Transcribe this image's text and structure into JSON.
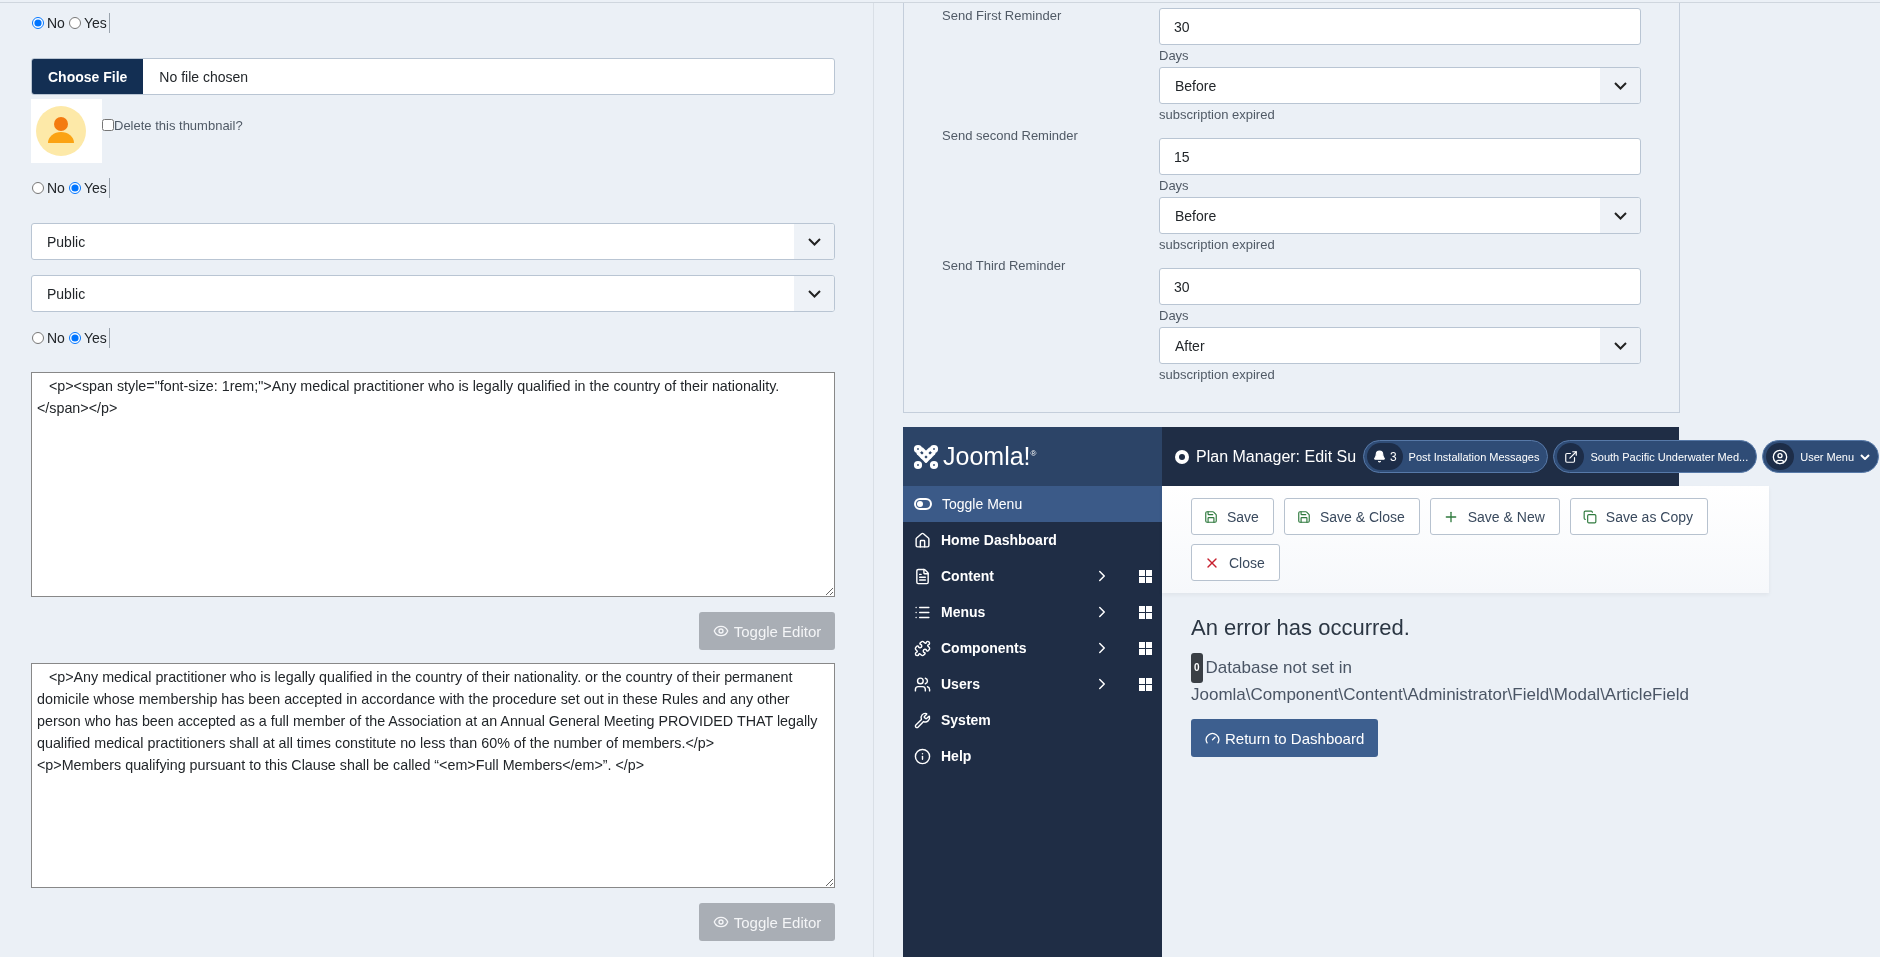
{
  "left_form": {
    "items": [
      {
        "kind": "radio",
        "options": [
          {
            "label": "No",
            "selected": true
          },
          {
            "label": "Yes",
            "selected": false
          }
        ]
      },
      {
        "kind": "file",
        "button": "Choose File",
        "status": "No file chosen"
      },
      {
        "kind": "thumbnail",
        "checkbox_label": "Delete this thumbnail?",
        "checked": false
      },
      {
        "kind": "radio",
        "options": [
          {
            "label": "No",
            "selected": false
          },
          {
            "label": "Yes",
            "selected": true
          }
        ]
      },
      {
        "kind": "select",
        "value": "Public"
      },
      {
        "kind": "select",
        "value": "Public"
      },
      {
        "kind": "radio",
        "options": [
          {
            "label": "No",
            "selected": false
          },
          {
            "label": "Yes",
            "selected": true
          }
        ]
      },
      {
        "kind": "editor",
        "value": "   <p><span style=\"font-size: 1rem;\">Any medical practitioner who is legally qualified in the country of their nationality.\n</span></p>",
        "toggle": {
          "label": "Toggle Editor",
          "disabled": true
        }
      },
      {
        "kind": "editor",
        "value": "   <p>Any medical practitioner who is legally qualified in the country of their nationality. or the country of their permanent domicile whose membership has been accepted in accordance with the procedure set out in these Rules and any other person who has been accepted as a full member of the Association at an Annual General Meeting PROVIDED THAT legally qualified medical practitioners shall at all times constitute no less than 60% of the number of members.</p>\n<p>Members qualifying pursuant to this Clause shall be called “<em>Full Members</em>”. </p>",
        "toggle": {
          "label": "Toggle Editor",
          "disabled": true
        }
      }
    ]
  },
  "reminders": [
    {
      "label": "Send First Reminder",
      "value": "30",
      "unit": "Days",
      "timing": "Before",
      "suffix": "subscription expired"
    },
    {
      "label": "Send second Reminder",
      "value": "15",
      "unit": "Days",
      "timing": "Before",
      "suffix": "subscription expired"
    },
    {
      "label": "Send Third Reminder",
      "value": "30",
      "unit": "Days",
      "timing": "After",
      "suffix": "subscription expired"
    }
  ],
  "admin_preview": {
    "logo": "Joomla!$^{®}$",
    "title": "Plan Manager: Edit Su",
    "notifications": {
      "count": "3",
      "label": "Post Installation Messages"
    },
    "site_link": "South Pacific Underwater Med...",
    "user_menu": "User Menu",
    "sidebar": [
      {
        "label": "Toggle Menu",
        "selected": true,
        "has_submenu": false
      },
      {
        "label": "Home Dashboard",
        "selected": false,
        "has_submenu": false
      },
      {
        "label": "Content",
        "selected": false,
        "has_submenu": true
      },
      {
        "label": "Menus",
        "selected": false,
        "has_submenu": true
      },
      {
        "label": "Components",
        "selected": false,
        "has_submenu": true
      },
      {
        "label": "Users",
        "selected": false,
        "has_submenu": true
      },
      {
        "label": "System",
        "selected": false,
        "has_submenu": false
      },
      {
        "label": "Help",
        "selected": false,
        "has_submenu": false
      }
    ],
    "toolbar": [
      "Save",
      "Save & Close",
      "Save & New",
      "Save as Copy",
      "Close"
    ],
    "error": {
      "heading": "An error has occurred.",
      "code": "0",
      "message": "Database not set in Joomla\\Component\\Content\\Administrator\\Field\\Modal\\ArticleField"
    },
    "return_button": "Return to Dashboard"
  }
}
